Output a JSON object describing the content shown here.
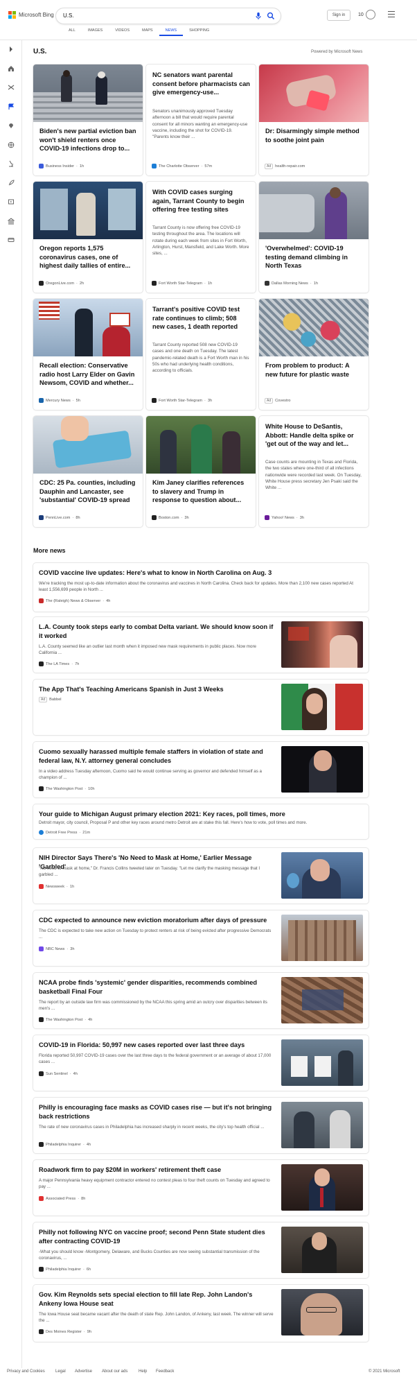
{
  "header": {
    "brand": "Microsoft Bing",
    "query": "U.S.",
    "signin": "Sign in",
    "reward_count": "10",
    "tabs": [
      "ALL",
      "IMAGES",
      "VIDEOS",
      "MAPS",
      "NEWS",
      "SHOPPING"
    ],
    "active_tab": "NEWS"
  },
  "section": {
    "title": "U.S.",
    "powered": "Powered by Microsoft News"
  },
  "cards": [
    {
      "title": "Biden's new partial eviction ban won't shield renters once COVID-19 infections drop to...",
      "snippet": "",
      "source": "Business Insider",
      "time": "1h",
      "ad": false,
      "fav": "#3b5bdb"
    },
    {
      "title": "NC senators want parental consent before pharmacists can give emergency-use...",
      "snippet": "Senators unanimously approved Tuesday afternoon a bill that would require parental consent for all minors wanting an emergency-use vaccine, including the shot for COVID-19. \"Parents know their ...",
      "source": "The Charlotte Observer",
      "time": "57m",
      "ad": false,
      "fav": "#1c7ed6"
    },
    {
      "title": "Dr: Disarmingly simple method to soothe joint pain",
      "snippet": "",
      "source": "health-repair.com",
      "time": "",
      "ad": true,
      "fav": ""
    },
    {
      "title": "Oregon reports 1,575 coronavirus cases, one of highest daily tallies of entire...",
      "snippet": "",
      "source": "OregonLive.com",
      "time": "2h",
      "ad": false,
      "fav": "#222"
    },
    {
      "title": "With COVID cases surging again, Tarrant County to begin offering free testing sites",
      "snippet": "Tarrant County is now offering free COVID-19 testing throughout the area. The locations will rotate during each week from sites in Fort Worth, Arlington, Hurst, Mansfield, and Lake Worth. More sites, ...",
      "source": "Fort Worth Star-Telegram",
      "time": "1h",
      "ad": false,
      "fav": "#222"
    },
    {
      "title": "'Overwhelmed': COVID-19 testing demand climbing in North Texas",
      "snippet": "",
      "source": "Dallas Morning News",
      "time": "1h",
      "ad": false,
      "fav": "#333"
    },
    {
      "title": "Recall election: Conservative radio host Larry Elder on Gavin Newsom, COVID and whether...",
      "snippet": "",
      "source": "Mercury News",
      "time": "5h",
      "ad": false,
      "fav": "#1864ab"
    },
    {
      "title": "Tarrant's positive COVID test rate continues to climb; 508 new cases, 1 death reported",
      "snippet": "Tarrant County reported 508 new COVID-19 cases and one death on Tuesday. The latest pandemic-related death is a Fort Worth man in his 50s who had underlying health conditions, according to officials.",
      "source": "Fort Worth Star-Telegram",
      "time": "3h",
      "ad": false,
      "fav": "#222"
    },
    {
      "title": "From problem to product: A new future for plastic waste",
      "snippet": "",
      "source": "Covestro",
      "time": "",
      "ad": true,
      "fav": ""
    },
    {
      "title": "CDC: 25 Pa. counties, including Dauphin and Lancaster, see 'substantial' COVID-19 spread",
      "snippet": "",
      "source": "PennLive.com",
      "time": "8h",
      "ad": false,
      "fav": "#1c3d7a"
    },
    {
      "title": "Kim Janey clarifies references to slavery and Trump in response to question about...",
      "snippet": "",
      "source": "Boston.com",
      "time": "3h",
      "ad": false,
      "fav": "#222"
    },
    {
      "title": "White House to DeSantis, Abbott: Handle delta spike or 'get out of the way and let...",
      "snippet": "Case counts are mounting in Texas and Florida, the two states where one-third of all infections nationwide were recorded last week. On Tuesday, White House press secretary Jen Psaki said the White ...",
      "source": "Yahoo! News",
      "time": "3h",
      "ad": false,
      "fav": "#6a1b9a"
    }
  ],
  "more_news_title": "More news",
  "more_news": [
    {
      "title": "COVID vaccine live updates: Here's what to know in North Carolina on Aug. 3",
      "snippet": "We're tracking the most up-to-date information about the coronavirus and vaccines in North Carolina. Check back for updates. More than 2,100 new cases reported At least 1,556,699 people in North ...",
      "source": "The (Raleigh) News & Observer",
      "time": "4h",
      "ad": false,
      "fav": "#c92a2a"
    },
    {
      "title": "L.A. County took steps early to combat Delta variant. We should know soon if it worked",
      "snippet": "L.A. County seemed like an outlier last month when it imposed new mask requirements in public places. Now more California ...",
      "source": "The LA Times",
      "time": "7h",
      "ad": false,
      "fav": "#222"
    },
    {
      "title": "The App That's Teaching Americans Spanish in Just 3 Weeks",
      "snippet": "",
      "source": "Babbel",
      "time": "",
      "ad": true,
      "fav": ""
    },
    {
      "title": "Cuomo sexually harassed multiple female staffers in violation of state and federal law, N.Y. attorney general concludes",
      "snippet": "In a video address Tuesday afternoon, Cuomo said he would continue serving as governor and defended himself as a champion of ...",
      "source": "The Washington Post",
      "time": "10h",
      "ad": false,
      "fav": "#222"
    },
    {
      "title": "Your guide to Michigan August primary election 2021: Key races, poll times, more",
      "snippet": "Detroit mayor, city council, Proposal P and other key races around metro Detroit are at stake this fall. Here's how to vote, poll times and more.",
      "source": "Detroit Free Press",
      "time": "21m",
      "ad": false,
      "fav": "#1c7ed6"
    },
    {
      "title": "NIH Director Says There's 'No Need to Mask at Home,' Earlier Message 'Garbled'",
      "snippet": "\"No need to mask at home,\" Dr. Francis Collins tweeted later on Tuesday. \"Let me clarify the masking message that I garbled ...",
      "source": "Newsweek",
      "time": "1h",
      "ad": false,
      "fav": "#e03131"
    },
    {
      "title": "CDC expected to announce new eviction moratorium after days of pressure",
      "snippet": "The CDC is expected to take new action on Tuesday to protect renters at risk of being evicted after progressive Democrats ...",
      "source": "NBC News",
      "time": "3h",
      "ad": false,
      "fav": "#7048e8"
    },
    {
      "title": "NCAA probe finds 'systemic' gender disparities, recommends combined basketball Final Four",
      "snippet": "The report by an outside law firm was commissioned by the NCAA this spring amid an outcry over disparities between its men's ...",
      "source": "The Washington Post",
      "time": "4h",
      "ad": false,
      "fav": "#222"
    },
    {
      "title": "COVID-19 in Florida: 50,997 new cases reported over last three days",
      "snippet": "Florida reported 50,997 COVID-19 cases over the last three days to the federal government or an average of about 17,000 cases ...",
      "source": "Sun Sentinel",
      "time": "4h",
      "ad": false,
      "fav": "#222"
    },
    {
      "title": "Philly is encouraging face masks as COVID cases rise — but it's not bringing back restrictions",
      "snippet": "The rate of new coronavirus cases in Philadelphia has increased sharply in recent weeks, the city's top health official ...",
      "source": "Philadelphia Inquirer",
      "time": "4h",
      "ad": false,
      "fav": "#222"
    },
    {
      "title": "Roadwork firm to pay $20M in workers' retirement theft case",
      "snippet": "A major Pennsylvania heavy equipment contractor entered no contest pleas to four theft counts on Tuesday and agreed to pay ...",
      "source": "Associated Press",
      "time": "8h",
      "ad": false,
      "fav": "#e03131"
    },
    {
      "title": "Philly not following NYC on vaccine proof; second Penn State student dies after contracting COVID-19",
      "snippet": "-What you should know -Montgomery, Delaware, and Bucks Counties are now seeing substantial transmission of the coronavirus, ...",
      "source": "Philadelphia Inquirer",
      "time": "6h",
      "ad": false,
      "fav": "#222"
    },
    {
      "title": "Gov. Kim Reynolds sets special election to fill late Rep. John Landon's Ankeny Iowa House seat",
      "snippet": "The Iowa House seat became vacant after the death of state Rep. John Landon, of Ankeny, last week. The winner will serve the ...",
      "source": "Des Moines Register",
      "time": "9h",
      "ad": false,
      "fav": "#222"
    }
  ],
  "footer": {
    "links": [
      "Privacy and Cookies",
      "Legal",
      "Advertise",
      "About our ads",
      "Help",
      "Feedback"
    ],
    "copyright": "© 2021 Microsoft"
  }
}
